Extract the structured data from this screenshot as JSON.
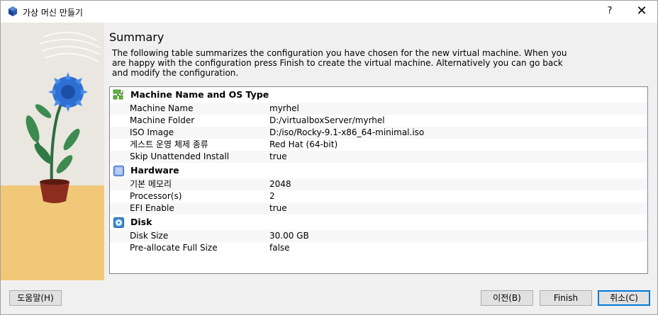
{
  "window": {
    "title": "가상 머신 만들기",
    "help_label": "?",
    "close_label": "✕"
  },
  "page": {
    "heading": "Summary",
    "description": "The following table summarizes the configuration you have chosen for the new virtual machine. When you are happy with the configuration press Finish to create the virtual machine. Alternatively you can go back and modify the configuration."
  },
  "sections": [
    {
      "title": "Machine Name and OS Type",
      "icon": "puzzle-icon",
      "rows": [
        {
          "key": "Machine Name",
          "value": "myrhel"
        },
        {
          "key": "Machine Folder",
          "value": "D:/virtualboxServer/myrhel"
        },
        {
          "key": "ISO Image",
          "value": "D:/iso/Rocky-9.1-x86_64-minimal.iso"
        },
        {
          "key": "게스트 운영 체제 종류",
          "value": "Red Hat (64-bit)"
        },
        {
          "key": "Skip Unattended Install",
          "value": "true"
        }
      ]
    },
    {
      "title": "Hardware",
      "icon": "chip-icon",
      "rows": [
        {
          "key": "기본 메모리",
          "value": "2048"
        },
        {
          "key": "Processor(s)",
          "value": "2"
        },
        {
          "key": "EFI Enable",
          "value": "true"
        }
      ]
    },
    {
      "title": "Disk",
      "icon": "disk-icon",
      "rows": [
        {
          "key": "Disk Size",
          "value": "30.00 GB"
        },
        {
          "key": "Pre-allocate Full Size",
          "value": "false"
        }
      ]
    }
  ],
  "buttons": {
    "help": "도움말(H)",
    "back": "이전(B)",
    "finish": "Finish",
    "cancel": "취소(C)"
  },
  "colors": {
    "accent": "#0078d7",
    "flower": "#2e6fd3",
    "leaf": "#3d8b4f",
    "pot": "#8b2e1f"
  }
}
